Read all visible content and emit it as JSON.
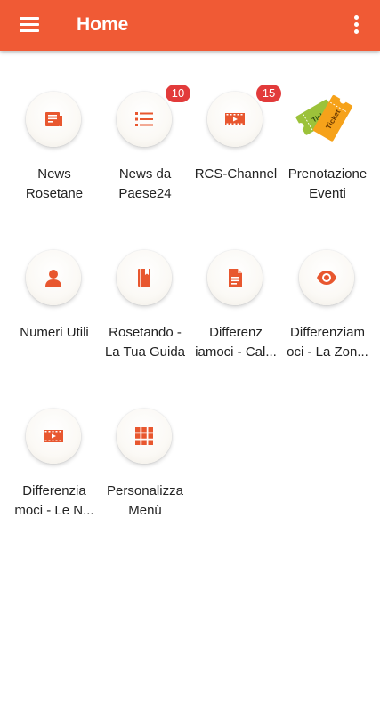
{
  "appbar": {
    "title": "Home",
    "menu_icon": "hamburger-menu-icon",
    "overflow_icon": "more-vertical-icon"
  },
  "colors": {
    "primary": "#f05a35",
    "icon": "#e8572f",
    "badge": "#e23b3b",
    "ticket_green": "#9cc23a",
    "ticket_orange": "#f6a21a"
  },
  "tiles": [
    {
      "label": "News\nRosetane",
      "icon": "newspaper-icon"
    },
    {
      "label": "News da\nPaese24",
      "icon": "list-icon",
      "badge": "10"
    },
    {
      "label": "RCS-Channel",
      "icon": "film-icon",
      "badge": "15"
    },
    {
      "label": "Prenotazione\nEventi",
      "icon": "ticket-icon",
      "ticket_text": "Ticket"
    },
    {
      "label": "Numeri Utili",
      "icon": "person-icon"
    },
    {
      "label": "Rosetando -\nLa Tua Guida",
      "icon": "book-icon"
    },
    {
      "label": "Differenz\niamoci - Cal...",
      "icon": "document-icon"
    },
    {
      "label": "Differenziam\noci - La Zon...",
      "icon": "eye-icon"
    },
    {
      "label": "Differenzia\nmoci - Le N...",
      "icon": "film-icon"
    },
    {
      "label": "Personalizza\nMenù",
      "icon": "grid-icon"
    }
  ]
}
